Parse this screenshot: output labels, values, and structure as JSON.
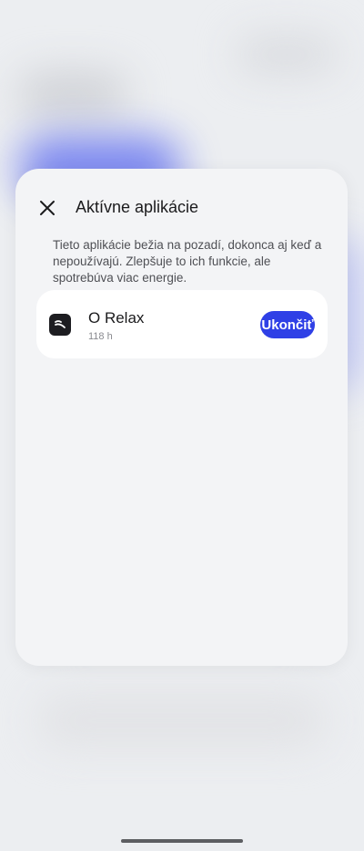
{
  "sheet": {
    "title": "Aktívne aplikácie",
    "description": "Tieto aplikácie bežia na pozadí, dokonca aj keď a nepoužívajú. Zlepšuje to ich funkcie, ale spotrebúva viac energie.",
    "close_icon": "close-icon"
  },
  "apps": [
    {
      "name": "O Relax",
      "usage": "118 h",
      "icon": "o-relax-app-icon",
      "stop_label": "Ukončiť"
    }
  ],
  "colors": {
    "accent": "#2f40e6",
    "panel_background": "#f3f4f6",
    "card_background": "#ffffff"
  }
}
